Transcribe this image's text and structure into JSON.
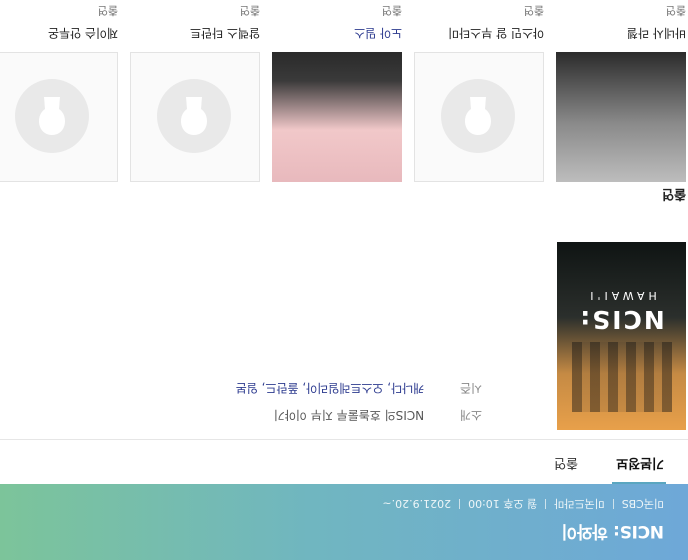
{
  "header": {
    "title": "NCIS: 하와이",
    "meta": [
      "미국CBS",
      "미국드라마",
      "월 오후 10:00",
      "2021.9.20.~"
    ]
  },
  "tabs": [
    {
      "label": "기본정보",
      "active": true
    },
    {
      "label": "출연",
      "active": false
    }
  ],
  "poster": {
    "logo": "NCIS:",
    "logo_sub": "HAWAI'I"
  },
  "info": {
    "rows": [
      {
        "label": "소개",
        "value": "NCIS의 호놀룰루 지부 이야기"
      },
      {
        "label": "시즌",
        "value": "캐나다, 오스트레일리아, 폴란드, 일본"
      }
    ]
  },
  "cast_section_title": "출연",
  "cast": [
    {
      "name": "바네사 라첼",
      "role": "출연",
      "photo": "gray-portrait"
    },
    {
      "name": "야스민 알 부스타미",
      "role": "출연",
      "photo": "placeholder"
    },
    {
      "name": "노아 밀스",
      "role": "출연",
      "photo": "pink-portrait",
      "link": true
    },
    {
      "name": "알렉스 타란트",
      "role": "출연",
      "photo": "placeholder"
    },
    {
      "name": "제이슨 안투온",
      "role": "출연",
      "photo": "placeholder"
    }
  ]
}
